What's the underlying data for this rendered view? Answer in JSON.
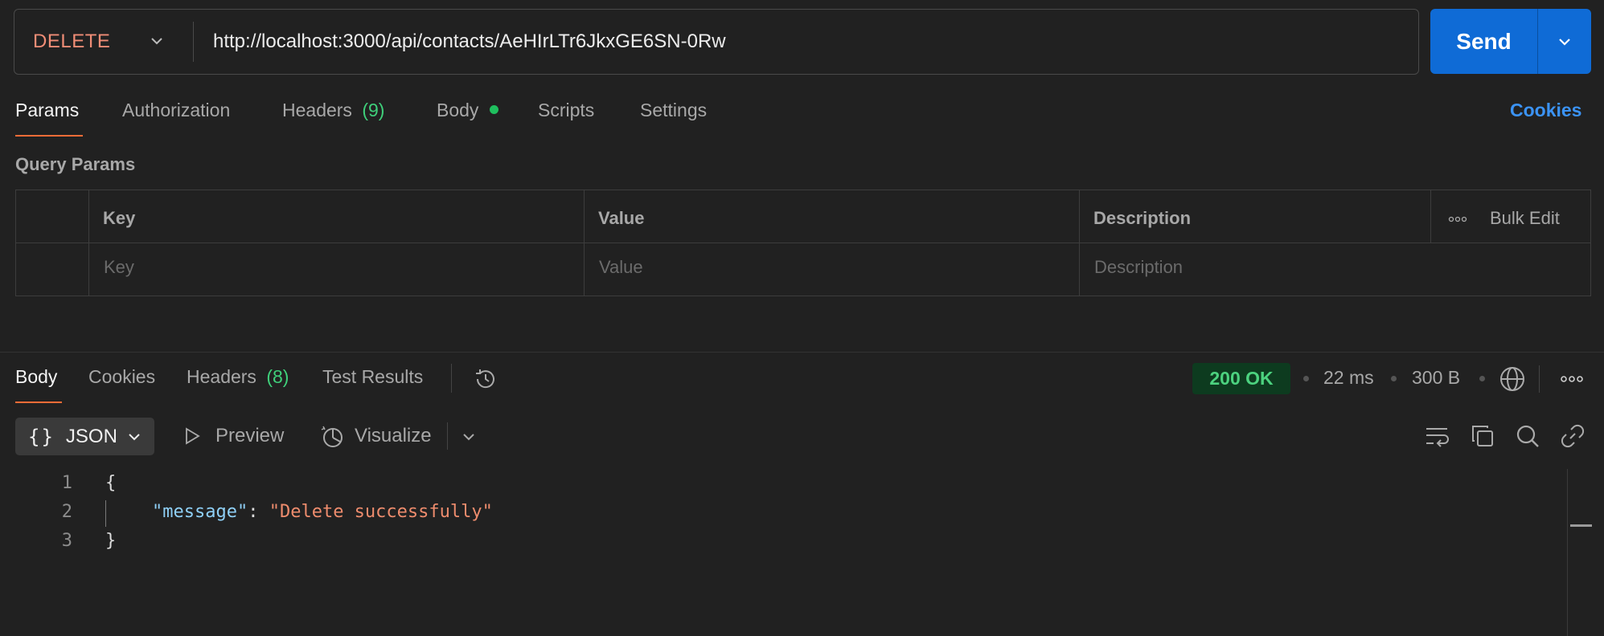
{
  "request": {
    "method": "DELETE",
    "url": "http://localhost:3000/api/contacts/AeHIrLTr6JkxGE6SN-0Rw",
    "send_label": "Send"
  },
  "request_tabs": [
    {
      "label": "Params",
      "active": true
    },
    {
      "label": "Authorization"
    },
    {
      "label": "Headers",
      "count": "(9)"
    },
    {
      "label": "Body",
      "indicator": "green-dot"
    },
    {
      "label": "Scripts"
    },
    {
      "label": "Settings"
    }
  ],
  "cookies_link": "Cookies",
  "query_params": {
    "title": "Query Params",
    "columns": [
      "Key",
      "Value",
      "Description"
    ],
    "bulk_edit": "Bulk Edit",
    "placeholders": {
      "key": "Key",
      "value": "Value",
      "description": "Description"
    }
  },
  "response_tabs": [
    {
      "label": "Body",
      "active": true
    },
    {
      "label": "Cookies"
    },
    {
      "label": "Headers",
      "count": "(8)"
    },
    {
      "label": "Test Results"
    }
  ],
  "response_meta": {
    "status": "200 OK",
    "time": "22 ms",
    "size": "300 B"
  },
  "response_toolbar": {
    "format": "JSON",
    "preview": "Preview",
    "visualize": "Visualize"
  },
  "response_body": {
    "line_numbers": [
      "1",
      "2",
      "3"
    ],
    "open_brace": "{",
    "close_brace": "}",
    "key": "\"message\"",
    "colon": ": ",
    "value": "\"Delete successfully\""
  },
  "colors": {
    "method_delete": "#f08d76",
    "send_button": "#0f6bd6",
    "tab_accent": "#ff6c37",
    "status_ok": "#4cd27f",
    "link": "#3b93f5"
  }
}
